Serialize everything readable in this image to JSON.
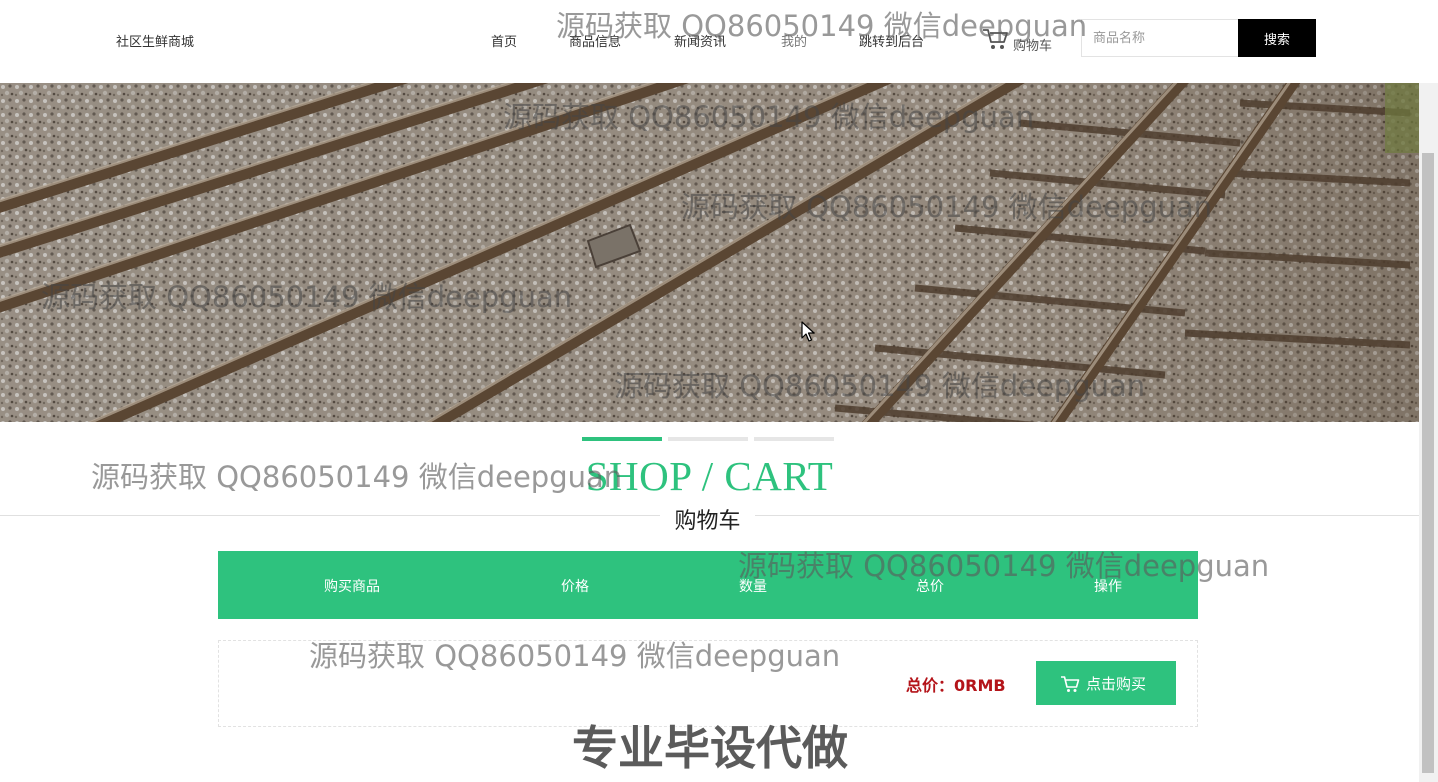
{
  "header": {
    "brand": "社区生鲜商城",
    "nav": [
      "首页",
      "商品信息",
      "新闻资讯",
      "我的",
      "跳转到后台"
    ],
    "cart_label": "购物车",
    "search_placeholder": "商品名称",
    "search_button": "搜索"
  },
  "section": {
    "title_en": "SHOP / CART",
    "title_cn": "购物车"
  },
  "cart": {
    "columns": [
      "购买商品",
      "价格",
      "数量",
      "总价",
      "操作"
    ],
    "total_label": "总价：0RMB",
    "buy_button": "点击购买"
  },
  "overlays": {
    "watermark": "源码获取 QQ86050149 微信deepguan",
    "promo": "专业毕设代做"
  },
  "colors": {
    "accent": "#2ec27e",
    "total_red": "#b4141a",
    "search_button_bg": "#000000"
  },
  "icons": [
    "cart-icon",
    "cart-icon-button",
    "mouse-cursor-icon"
  ]
}
